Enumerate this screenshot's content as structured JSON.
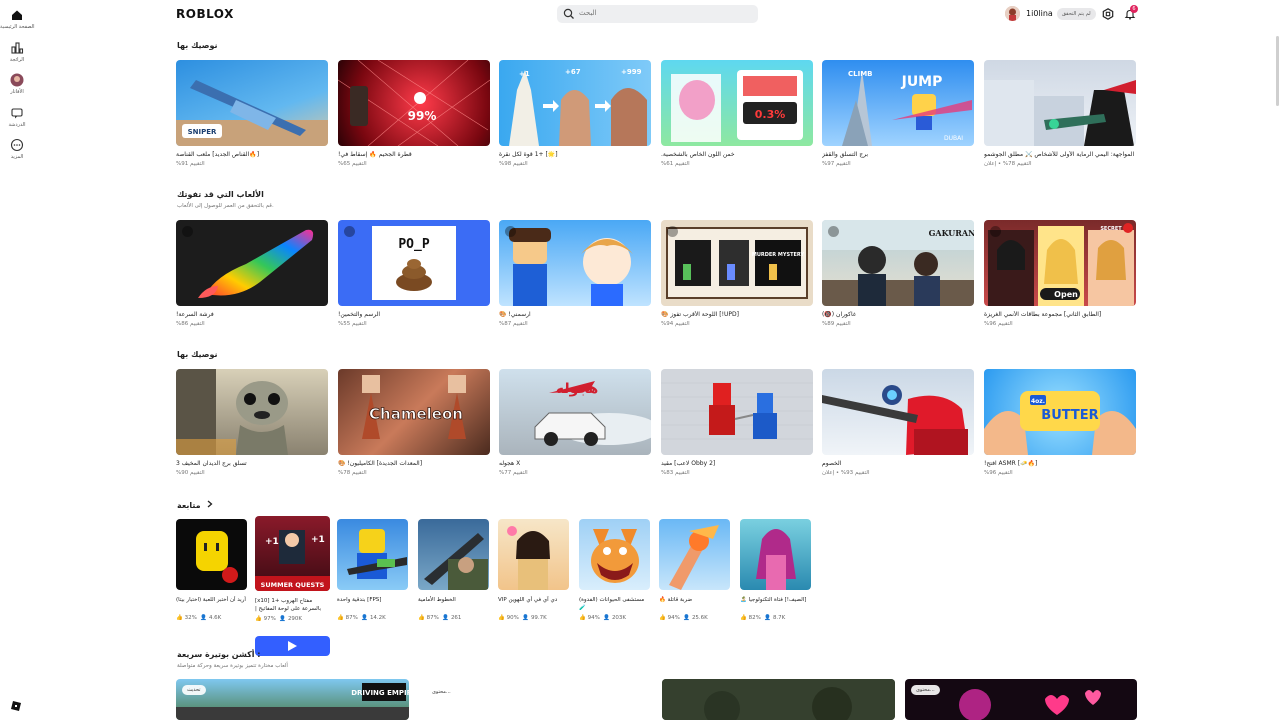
{
  "rail": {
    "items": [
      {
        "label": "الصفحة الرئيسية",
        "icon": "home-icon"
      },
      {
        "label": "الرائجة",
        "icon": "charts-icon"
      },
      {
        "label": "الأفاتار",
        "icon": "avatar-icon"
      },
      {
        "label": "الدردشة",
        "icon": "chat-icon"
      },
      {
        "label": "المزيد",
        "icon": "more-icon"
      }
    ]
  },
  "header": {
    "logo": "ROBLOX",
    "search_placeholder": "البحث",
    "username": "1i0lina",
    "verify_label": "لم يتم التحقق"
  },
  "notifications": {
    "count": "6"
  },
  "sections": {
    "s1": {
      "title": "نوصيك بها"
    },
    "s2": {
      "title": "الألعاب التي قد تفوتك",
      "subtitle": "قم بالتحقق من العمر للوصول إلى الألعاب."
    },
    "s3": {
      "title": "نوصيك بها"
    },
    "s4": {
      "title": "متابعة"
    },
    "s5": {
      "title": "أكشن بوتيرة سريعة :",
      "subtitle": "ألعاب مختارة تتميز بوتيرة سريعة وحركة متواصلة"
    }
  },
  "row1": [
    {
      "title": "[🔥القناص الجديد] ملعب القناصة",
      "meta": "التقييم 91%"
    },
    {
      "title": "قطرة الجحيم 🔥 إسقاط في!",
      "meta": "التقييم 65%"
    },
    {
      "title": "[🌟] +1 قوة لكل نقرة",
      "meta": "التقييم 98%"
    },
    {
      "title": "خمن اللون الخاص بالشخصية.",
      "meta": "التقييم 61%"
    },
    {
      "title": "برج التسلق والقفز",
      "meta": "التقييم 97%"
    },
    {
      "title": "المواجهة: اليمي الرماية الأولى للأشخاص ⚔️ مطلق الجوشمو",
      "meta": "التقييم 78% • إعلان"
    }
  ],
  "row2": [
    {
      "title": "فرشة السرعة!",
      "meta": "التقييم 86%"
    },
    {
      "title": "الرسم والتخمين!",
      "meta": "التقييم 55%"
    },
    {
      "title": "ارسمني! 🎨",
      "meta": "التقييم 87%"
    },
    {
      "title": "[UPD!] اللوحة الأقرب تفوز 🎨",
      "meta": "التقييم 94%"
    },
    {
      "title": "غاكوران (🔞)",
      "meta": "التقييم 89%"
    },
    {
      "title": "[الطابق الثاني] مجموعة بطاقات الأنمي الغريزة",
      "meta": "التقييم 96%"
    }
  ],
  "row3": [
    {
      "title": "تسلق برج الديدان المخيف 3",
      "meta": "التقييم 90%"
    },
    {
      "title": "[المعدات الجديدة] الكاميليون! 🎨",
      "meta": "التقييم 78%"
    },
    {
      "title": "X هجوله",
      "meta": "التقييم 77%"
    },
    {
      "title": "[Obby 2 لاعب] مقيد",
      "meta": "التقييم 83%"
    },
    {
      "title": "الخصوم",
      "meta": "التقييم 93% • إعلان"
    },
    {
      "title": "[🔥🧈] ASMR افتح!",
      "meta": "التقييم 96%"
    }
  ],
  "row4": [
    {
      "title": "أريد أن أختبر اللعبة (اختبار بيتا)",
      "rating": "32%",
      "players": "4.6K"
    },
    {
      "title": "مفتاح الهروب +1 [x10] بالسرعة على لوحة المفاتيح |",
      "rating": "97%",
      "players": "290K"
    },
    {
      "title": "[FPS] بندقية واحدة",
      "rating": "87%",
      "players": "14.2K"
    },
    {
      "title": "الخطوط الأمامية",
      "rating": "87%",
      "players": "261"
    },
    {
      "title": "دي آي في أي اللهوين VIP",
      "rating": "90%",
      "players": "99.7K"
    },
    {
      "title": "مستشفى الحيوانات (الفدوة) 🧪",
      "rating": "94%",
      "players": "203K"
    },
    {
      "title": "ضربة قاتلة 🔥",
      "rating": "94%",
      "players": "25.6K"
    },
    {
      "title": "[الصيف!] فتاة التكنولوجيا 🏝️",
      "rating": "82%",
      "players": "8.7K"
    }
  ],
  "row5": [
    {
      "tag": "تحديث"
    },
    {
      "tag": "محتوى..."
    },
    {
      "tag": ""
    },
    {
      "tag": "محتوى..."
    }
  ],
  "thumb_texts": {
    "t2": "99%",
    "t3a": "+1",
    "t3b": "+67",
    "t3c": "+999",
    "t4": "0.3%",
    "t5": "JUMP",
    "t5b": "CLIMB",
    "t5c": "DUBAI",
    "t1": "SNIPER",
    "r2t2": "PO_P",
    "r2t4": "MURDER MYSTERY",
    "r2t5": "GAKURAN",
    "r2t6": "Open",
    "r2t6b": "SECRET",
    "r3t2": "Chameleon",
    "r3t3": "هجوله",
    "r3t6": "BUTTER",
    "r3t6b": "4oz.",
    "r4t2": "SUMMER QUESTS",
    "r5t1": "DRIVING EMPIRE"
  }
}
